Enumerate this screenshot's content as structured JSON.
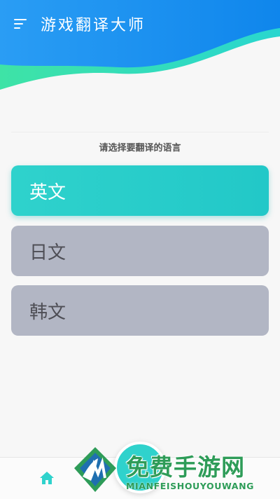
{
  "header": {
    "title": "游戏翻译大师"
  },
  "prompt": "请选择要翻译的语言",
  "languages": [
    {
      "label": "英文",
      "selected": true
    },
    {
      "label": "日文",
      "selected": false
    },
    {
      "label": "韩文",
      "selected": false
    }
  ],
  "watermark": {
    "title": "免费手游网",
    "subtitle": "MIANFEISHOUYOUWANG"
  },
  "colors": {
    "header_blue": "#1a8ef0",
    "accent_teal": "#2fd2cc",
    "wave_green": "#3ee3a6",
    "inactive_button": "#b2b6c4",
    "background": "#f7f7f7"
  },
  "icons": [
    "menu-icon",
    "home-icon"
  ]
}
